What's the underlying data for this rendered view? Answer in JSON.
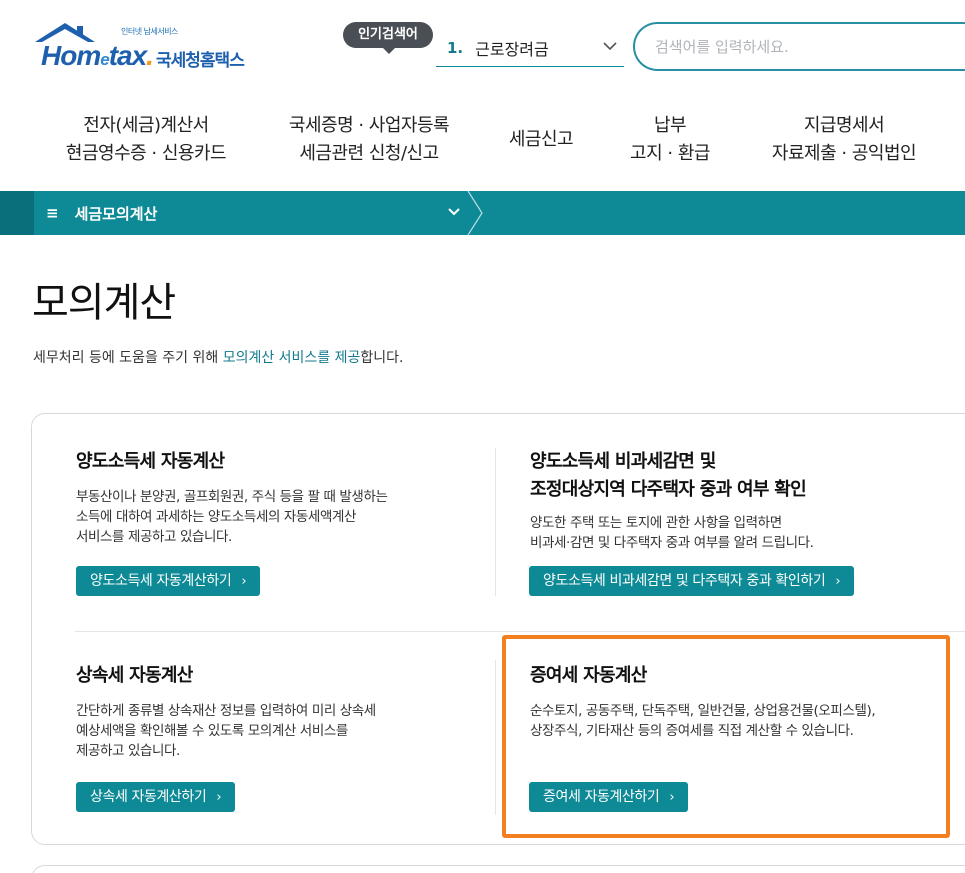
{
  "header": {
    "logo_tagline": "인터넷 납세서비스",
    "logo_word_a": "Hom",
    "logo_word_e": "e",
    "logo_word_b": "tax",
    "logo_word_dot": ".",
    "logo_kr": "국세청홈택스",
    "popular_badge": "인기검색어",
    "popular_rank": "1.",
    "popular_keyword": "근로장려금",
    "search_placeholder": "검색어를 입력하세요."
  },
  "gnb": [
    {
      "line1": "전자(세금)계산서",
      "line2": "현금영수증 · 신용카드"
    },
    {
      "line1": "국세증명 · 사업자등록",
      "line2": "세금관련 신청/신고"
    },
    {
      "line1": "세금신고",
      "line2": ""
    },
    {
      "line1": "납부",
      "line2": "고지 · 환급"
    },
    {
      "line1": "지급명세서",
      "line2": "자료제출 · 공익법인"
    }
  ],
  "subnav": {
    "menu_label": "세금모의계산"
  },
  "page": {
    "title": "모의계산",
    "desc_pre": "세무처리 등에 도움을 주기 위해 ",
    "desc_highlight": "모의계산 서비스를 제공",
    "desc_post": "합니다."
  },
  "services": [
    {
      "title_line1": "양도소득세 자동계산",
      "title_line2": "",
      "desc": [
        "부동산이나 분양권, 골프회원권, 주식 등을 팔 때 발생하는",
        "소득에 대하여 과세하는 양도소득세의 자동세액계산",
        "서비스를 제공하고 있습니다."
      ],
      "button": "양도소득세 자동계산하기"
    },
    {
      "title_line1": "양도소득세 비과세감면 및",
      "title_line2": "조정대상지역 다주택자 중과 여부 확인",
      "desc": [
        "양도한 주택 또는 토지에 관한 사항을 입력하면",
        "비과세·감면 및 다주택자 중과 여부를 알려 드립니다."
      ],
      "button": "양도소득세 비과세감면 및 다주택자 중과 확인하기"
    },
    {
      "title_line1": "상속세 자동계산",
      "title_line2": "",
      "desc": [
        "간단하게 종류별 상속재산 정보를 입력하여 미리 상속세",
        "예상세액을 확인해볼 수 있도록 모의계산 서비스를",
        "제공하고 있습니다."
      ],
      "button": "상속세 자동계산하기"
    },
    {
      "title_line1": "증여세 자동계산",
      "title_line2": "",
      "desc": [
        "순수토지, 공동주택, 단독주택, 일반건물, 상업용건물(오피스텔),",
        "상장주식, 기타재산 등의 증여세를 직접 계산할 수 있습니다."
      ],
      "button": "증여세 자동계산하기"
    }
  ],
  "icons": {
    "arrow": "›",
    "hamburger": "≡"
  },
  "colors": {
    "teal": "#0d8a96",
    "brand_blue": "#1e5fae",
    "highlight": "#f47f20"
  }
}
